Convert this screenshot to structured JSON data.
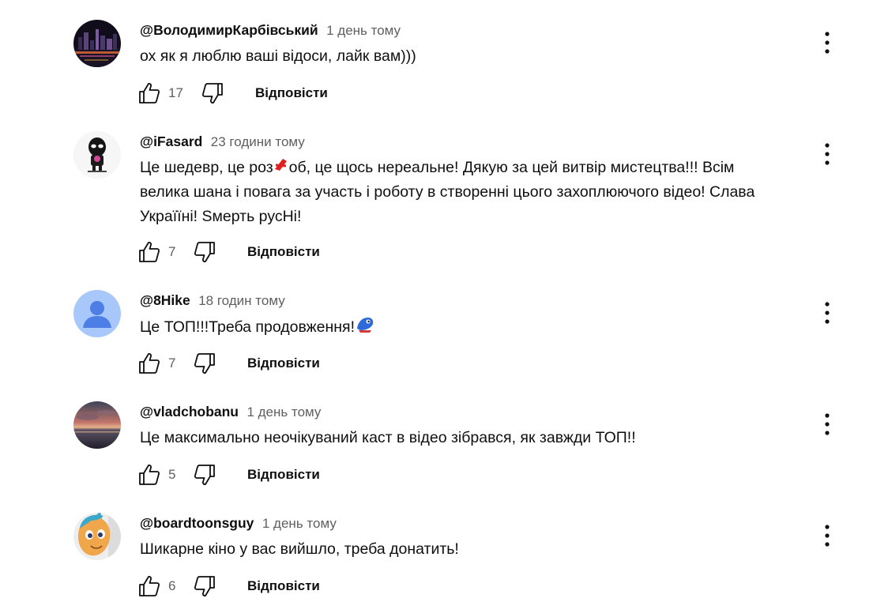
{
  "comments": [
    {
      "author": "@ВолодимирКарбівський",
      "time": "1 день тому",
      "text": "ох як я люблю ваші відоси, лайк вам)))",
      "likes": "17",
      "reply_label": "Відповісти",
      "avatar_icon": "city-night-avatar"
    },
    {
      "author": "@iFasard",
      "time": "23 години тому",
      "text_before_emoji": "Це шедевр, це роз",
      "text_after_emoji": "об, це щось нереальне! Дякую за цей витвір мистецтва!!! Всім велика шана і повага за участь і роботу в створенні цього захоплюючого відео! Слава Україїні! Ѕмерть русНі!",
      "likes": "7",
      "reply_label": "Відповісти",
      "avatar_icon": "alien-character-avatar"
    },
    {
      "author": "@8Hike",
      "time": "18 годин тому",
      "text": "Це ТОП!!!Треба продовження!",
      "likes": "7",
      "reply_label": "Відповісти",
      "avatar_icon": "default-person-avatar"
    },
    {
      "author": "@vladchobanu",
      "time": "1 день тому",
      "text": "Це максимально неочікуваний каст в відео зібрався, як завжди ТОП!!",
      "likes": "5",
      "reply_label": "Відповісти",
      "avatar_icon": "sunset-sea-avatar"
    },
    {
      "author": "@boardtoonsguy",
      "time": "1 день тому",
      "text": "Шикарне кіно у вас вийшло, треба донатить!",
      "likes": "6",
      "reply_label": "Відповісти",
      "avatar_icon": "cartoon-pony-avatar"
    }
  ],
  "colors": {
    "text": "#0f0f0f",
    "secondary": "#606060",
    "default_avatar_bg": "#a8c7fa",
    "default_avatar_fg": "#4d7ee6"
  }
}
